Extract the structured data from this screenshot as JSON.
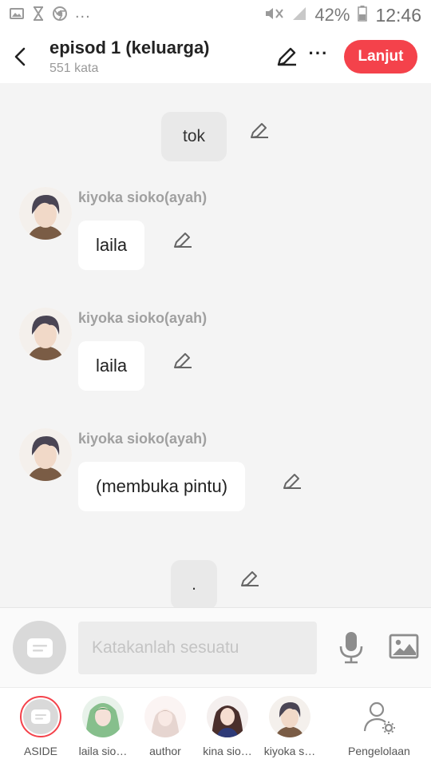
{
  "status_bar": {
    "battery": "42%",
    "time": "12:46",
    "overflow": "..."
  },
  "header": {
    "title": "episod 1 (keluarga)",
    "word_count": "551 kata",
    "more": "···",
    "next_button": "Lanjut"
  },
  "colors": {
    "accent": "#f4424b",
    "chat_bg": "#f4f4f4",
    "bubble": "#ffffff",
    "narration": "#e9e9e9"
  },
  "chat": {
    "narration_1": "tok",
    "messages": [
      {
        "speaker": "kiyoka sioko(ayah)",
        "text": "laila"
      },
      {
        "speaker": "kiyoka sioko(ayah)",
        "text": "laila"
      },
      {
        "speaker": "kiyoka sioko(ayah)",
        "text": "(membuka pintu)"
      }
    ],
    "narration_2": "."
  },
  "input": {
    "placeholder": "Katakanlah sesuatu",
    "value": ""
  },
  "characters": [
    {
      "label": "ASIDE",
      "icon": "aside-icon"
    },
    {
      "label": "laila sio…",
      "icon": "avatar-laila"
    },
    {
      "label": "author",
      "icon": "avatar-author"
    },
    {
      "label": "kina sio…",
      "icon": "avatar-kina"
    },
    {
      "label": "kiyoka s…",
      "icon": "avatar-kiyoka"
    },
    {
      "label": "Pengelolaan",
      "icon": "manage-user-icon"
    }
  ]
}
